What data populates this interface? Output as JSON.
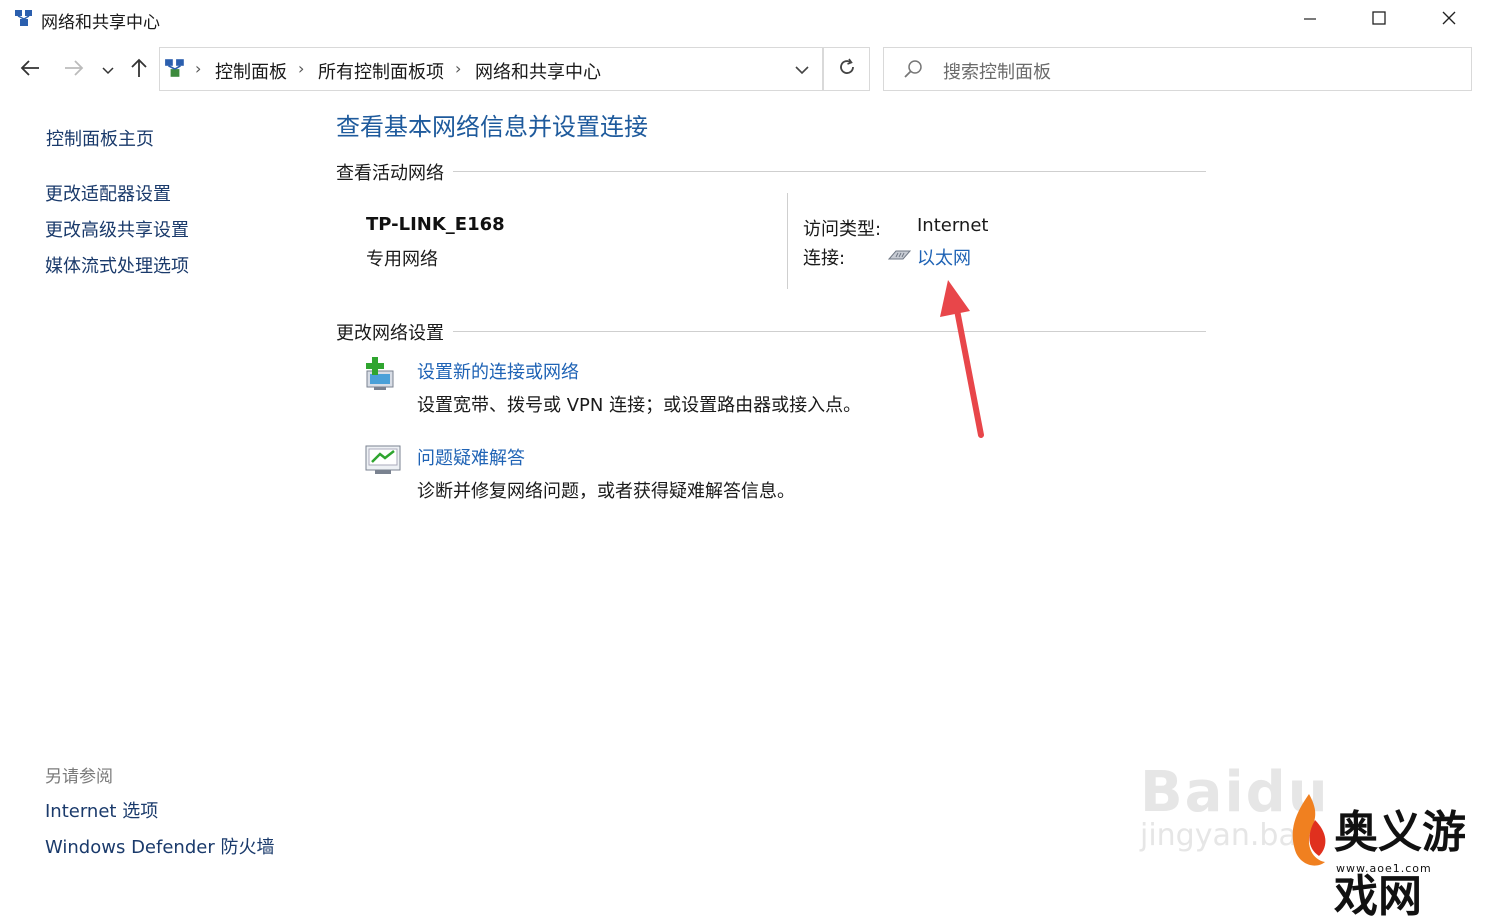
{
  "window": {
    "title": "网络和共享中心",
    "icons": [
      "network-center-icon",
      "minimize-icon",
      "maximize-icon",
      "close-icon"
    ]
  },
  "nav": {
    "icons": [
      "back-arrow-icon",
      "forward-arrow-icon",
      "recent-chevron-icon",
      "up-arrow-icon",
      "dropdown-chevron-icon",
      "refresh-icon"
    ],
    "breadcrumb": [
      "控制面板",
      "所有控制面板项",
      "网络和共享中心"
    ],
    "breadcrumb_separator": "›",
    "search_placeholder": "搜索控制面板"
  },
  "sidebar": {
    "home": "控制面板主页",
    "items": [
      "更改适配器设置",
      "更改高级共享设置",
      "媒体流式处理选项"
    ],
    "see_also_title": "另请参阅",
    "see_also": [
      "Internet 选项",
      "Windows Defender 防火墙"
    ]
  },
  "main": {
    "heading": "查看基本网络信息并设置连接",
    "active_networks_title": "查看活动网络",
    "network": {
      "name": "TP-LINK_E168",
      "type": "专用网络",
      "access_type_label": "访问类型:",
      "access_type_value": "Internet",
      "connection_label": "连接:",
      "connection_value": "以太网"
    },
    "change_settings_title": "更改网络设置",
    "tasks": [
      {
        "title": "设置新的连接或网络",
        "desc": "设置宽带、拨号或 VPN 连接；或设置路由器或接入点。",
        "icon": "new-connection-icon"
      },
      {
        "title": "问题疑难解答",
        "desc": "诊断并修复网络问题，或者获得疑难解答信息。",
        "icon": "troubleshoot-icon"
      }
    ]
  },
  "annotation": {
    "color": "#e8464a",
    "icon": "red-arrow-annotation"
  },
  "watermark": {
    "baidu": "Baidu",
    "jingyan": "jingyan.ba",
    "logo_text": "奥义游戏网",
    "logo_url": "www.aoe1.com"
  },
  "colors": {
    "link": "#1f63b5",
    "heading": "#1e5a9c"
  }
}
